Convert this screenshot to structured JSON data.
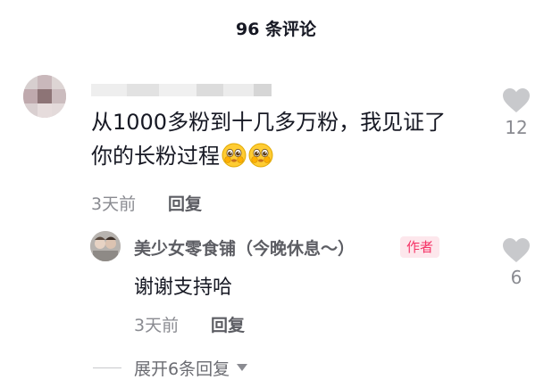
{
  "header": {
    "title": "96 条评论"
  },
  "comment": {
    "text_line1": "从1000多粉到十几多万粉，我见证了",
    "text_line2": "你的长粉过程",
    "emoji_names": [
      "pleading-face-emoji",
      "pleading-face-emoji"
    ],
    "time": "3天前",
    "reply_label": "回复",
    "likes": "12"
  },
  "reply": {
    "author": "美少女零食铺（今晚休息～）",
    "badge": "作者",
    "text": "谢谢支持哈",
    "time": "3天前",
    "reply_label": "回复",
    "likes": "6"
  },
  "expand": {
    "label": "展开6条回复"
  },
  "colors": {
    "text": "#161823",
    "secondary": "#8a8b91",
    "heart": "#c8c9cc",
    "badge_bg": "#fde7ec",
    "badge_text": "#f53366"
  }
}
